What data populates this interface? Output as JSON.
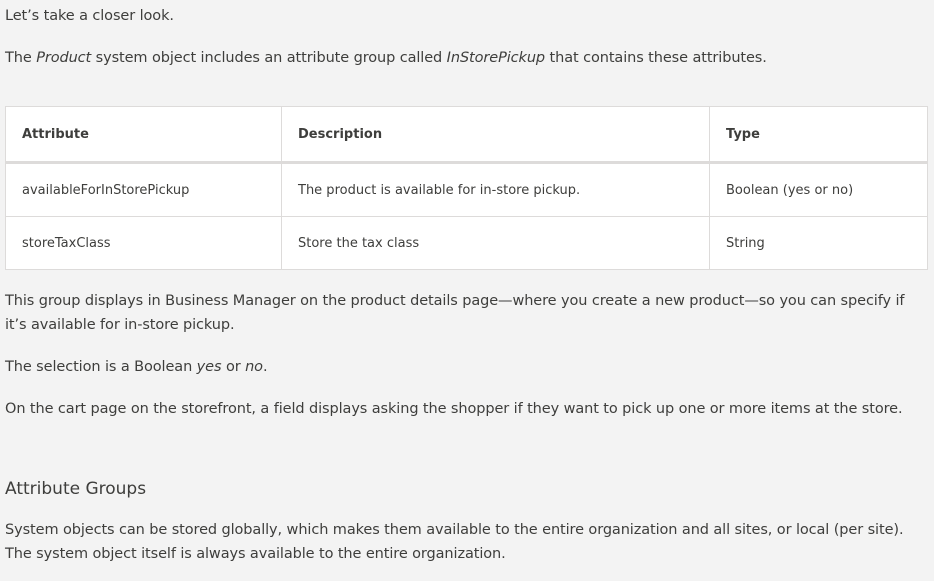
{
  "intro": "Let’s take a closer look.",
  "lead": {
    "part1": "The ",
    "product": "Product",
    "part2": " system object includes an attribute group called ",
    "group": "InStorePickup",
    "part3": " that contains these attributes."
  },
  "table": {
    "headers": [
      "Attribute",
      "Description",
      "Type"
    ],
    "rows": [
      [
        "availableForInStorePickup",
        "The product is available for in-store pickup.",
        "Boolean (yes or no)"
      ],
      [
        "storeTaxClass",
        "Store the tax class",
        "String"
      ]
    ]
  },
  "group_paragraph": "This group displays in Business Manager on the product details page—where you create a new product—so you can specify if it’s available for in-store pickup.",
  "boolean_paragraph": {
    "part1": "The selection is a Boolean ",
    "yes": "yes",
    "part2": " or ",
    "no": "no",
    "part3": "."
  },
  "cart_paragraph": "On the cart page on the storefront, a field displays asking the shopper if they want to pick up one or more items at the store.",
  "section_heading": "Attribute Groups",
  "system_paragraph": "System objects can be stored globally, which makes them available to the entire organization and all sites, or local (per site). The system object itself is always available to the entire organization."
}
